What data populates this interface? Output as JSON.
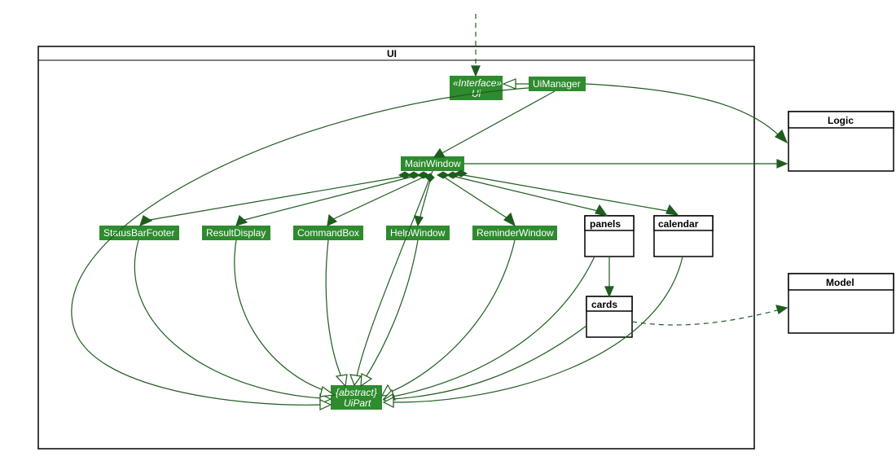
{
  "diagram": {
    "package_frame": {
      "label": "UI"
    },
    "interface": {
      "stereotype": "«Interface»",
      "name": "Ui"
    },
    "uiManager": "UiManager",
    "mainWindow": "MainWindow",
    "components": {
      "statusBarFooter": "StatusBarFooter",
      "resultDisplay": "ResultDisplay",
      "commandBox": "CommandBox",
      "helpWindow": "HelpWindow",
      "reminderWindow": "ReminderWindow"
    },
    "subpackages": {
      "panels": "panels",
      "cards": "cards",
      "calendar": "calendar"
    },
    "uiPart": {
      "constraint": "{abstract}",
      "name": "UiPart"
    },
    "external": {
      "logic": "Logic",
      "model": "Model"
    },
    "relationships": [
      {
        "from": "external-top",
        "to": "Ui",
        "type": "dependency"
      },
      {
        "from": "UiManager",
        "to": "Ui",
        "type": "realization"
      },
      {
        "from": "UiManager",
        "to": "MainWindow",
        "type": "association-arrow"
      },
      {
        "from": "UiManager",
        "to": "Logic",
        "type": "association-arrow"
      },
      {
        "from": "MainWindow",
        "to": "Logic",
        "type": "association-arrow"
      },
      {
        "from": "MainWindow",
        "to": "StatusBarFooter",
        "type": "composition"
      },
      {
        "from": "MainWindow",
        "to": "ResultDisplay",
        "type": "composition"
      },
      {
        "from": "MainWindow",
        "to": "CommandBox",
        "type": "composition"
      },
      {
        "from": "MainWindow",
        "to": "HelpWindow",
        "type": "composition"
      },
      {
        "from": "MainWindow",
        "to": "ReminderWindow",
        "type": "composition"
      },
      {
        "from": "MainWindow",
        "to": "panels",
        "type": "composition"
      },
      {
        "from": "MainWindow",
        "to": "calendar",
        "type": "composition"
      },
      {
        "from": "panels",
        "to": "cards",
        "type": "association-arrow"
      },
      {
        "from": "cards",
        "to": "Model",
        "type": "dependency"
      },
      {
        "from": "UiManager",
        "to": "UiPart",
        "type": "generalization"
      },
      {
        "from": "MainWindow",
        "to": "UiPart",
        "type": "generalization"
      },
      {
        "from": "StatusBarFooter",
        "to": "UiPart",
        "type": "generalization"
      },
      {
        "from": "ResultDisplay",
        "to": "UiPart",
        "type": "generalization"
      },
      {
        "from": "CommandBox",
        "to": "UiPart",
        "type": "generalization"
      },
      {
        "from": "HelpWindow",
        "to": "UiPart",
        "type": "generalization"
      },
      {
        "from": "ReminderWindow",
        "to": "UiPart",
        "type": "generalization"
      },
      {
        "from": "panels",
        "to": "UiPart",
        "type": "generalization"
      },
      {
        "from": "cards",
        "to": "UiPart",
        "type": "generalization"
      },
      {
        "from": "calendar",
        "to": "UiPart",
        "type": "generalization"
      }
    ]
  }
}
